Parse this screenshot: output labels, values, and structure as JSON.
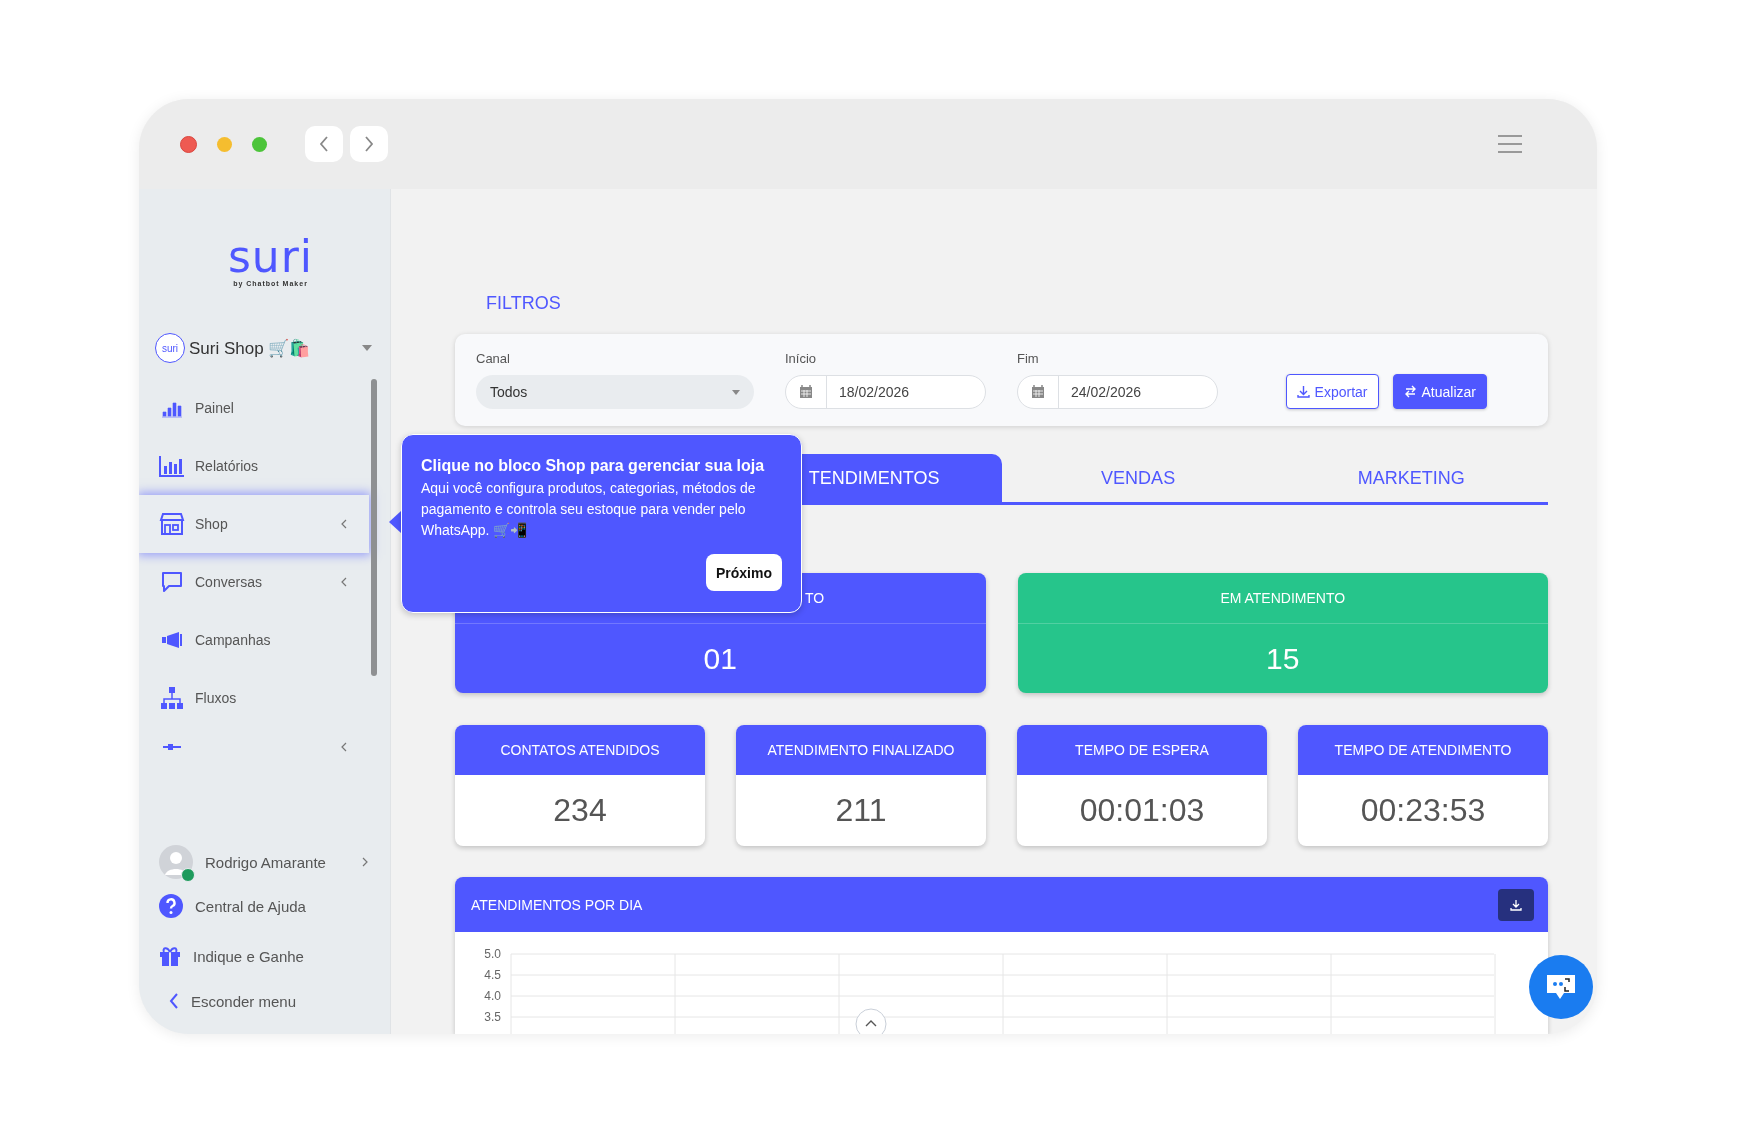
{
  "logo": {
    "name": "suri",
    "tagline": "by Chatbot Maker"
  },
  "workspace": {
    "badge": "suri",
    "name": "Suri Shop 🛒🛍️"
  },
  "sidebar": {
    "items": [
      {
        "label": "Painel",
        "selected": false,
        "submenu": false
      },
      {
        "label": "Relatórios",
        "selected": false,
        "submenu": false
      },
      {
        "label": "Shop",
        "selected": true,
        "submenu": true
      },
      {
        "label": "Conversas",
        "selected": false,
        "submenu": true
      },
      {
        "label": "Campanhas",
        "selected": false,
        "submenu": false
      },
      {
        "label": "Fluxos",
        "selected": false,
        "submenu": false
      },
      {
        "selected": false,
        "submenu": true
      }
    ]
  },
  "user": {
    "name": "Rodrigo Amarante",
    "online": true
  },
  "footer_links": [
    {
      "label": "Central de Ajuda"
    },
    {
      "label": "Indique e Ganhe"
    },
    {
      "label": "Esconder menu"
    }
  ],
  "filters": {
    "title": "FILTROS",
    "fields": [
      {
        "kind": "select",
        "label": "Canal",
        "value": "Todos"
      },
      {
        "kind": "date",
        "label": "Início",
        "value": "18/02/2026"
      },
      {
        "kind": "date",
        "label": "Fim",
        "value": "24/02/2026"
      }
    ],
    "buttons": [
      {
        "kind": "outline",
        "label": "Exportar"
      },
      {
        "kind": "solid",
        "label": "Atualizar"
      }
    ]
  },
  "tabs": [
    {
      "label": "TENDIMENTOS",
      "selected": true
    },
    {
      "label": "VENDAS",
      "selected": false
    },
    {
      "label": "MARKETING",
      "selected": false
    }
  ],
  "status_cards": [
    {
      "title": "TO",
      "value": "01",
      "color": "#4f57ff",
      "partial": true
    },
    {
      "title": "EM ATENDIMENTO",
      "value": "15",
      "color": "#26c58b",
      "partial": false
    }
  ],
  "metrics": [
    {
      "title": "CONTATOS ATENDIDOS",
      "value": "234"
    },
    {
      "title": "ATENDIMENTO FINALIZADO",
      "value": "211"
    },
    {
      "title": "TEMPO DE ESPERA",
      "value": "00:01:03"
    },
    {
      "title": "TEMPO DE ATENDIMENTO",
      "value": "00:23:53"
    }
  ],
  "chart_panel": {
    "title": "ATENDIMENTOS POR DIA",
    "y_labels": [
      "5.0",
      "4.5",
      "4.0",
      "3.5"
    ]
  },
  "tour_tooltip": {
    "title": "Clique no bloco Shop para gerenciar sua loja",
    "body": "Aqui você configura produtos, categorias, métodos de pagamento e controla seu estoque para vender pelo WhatsApp. 🛒📲",
    "button": "Próximo"
  }
}
